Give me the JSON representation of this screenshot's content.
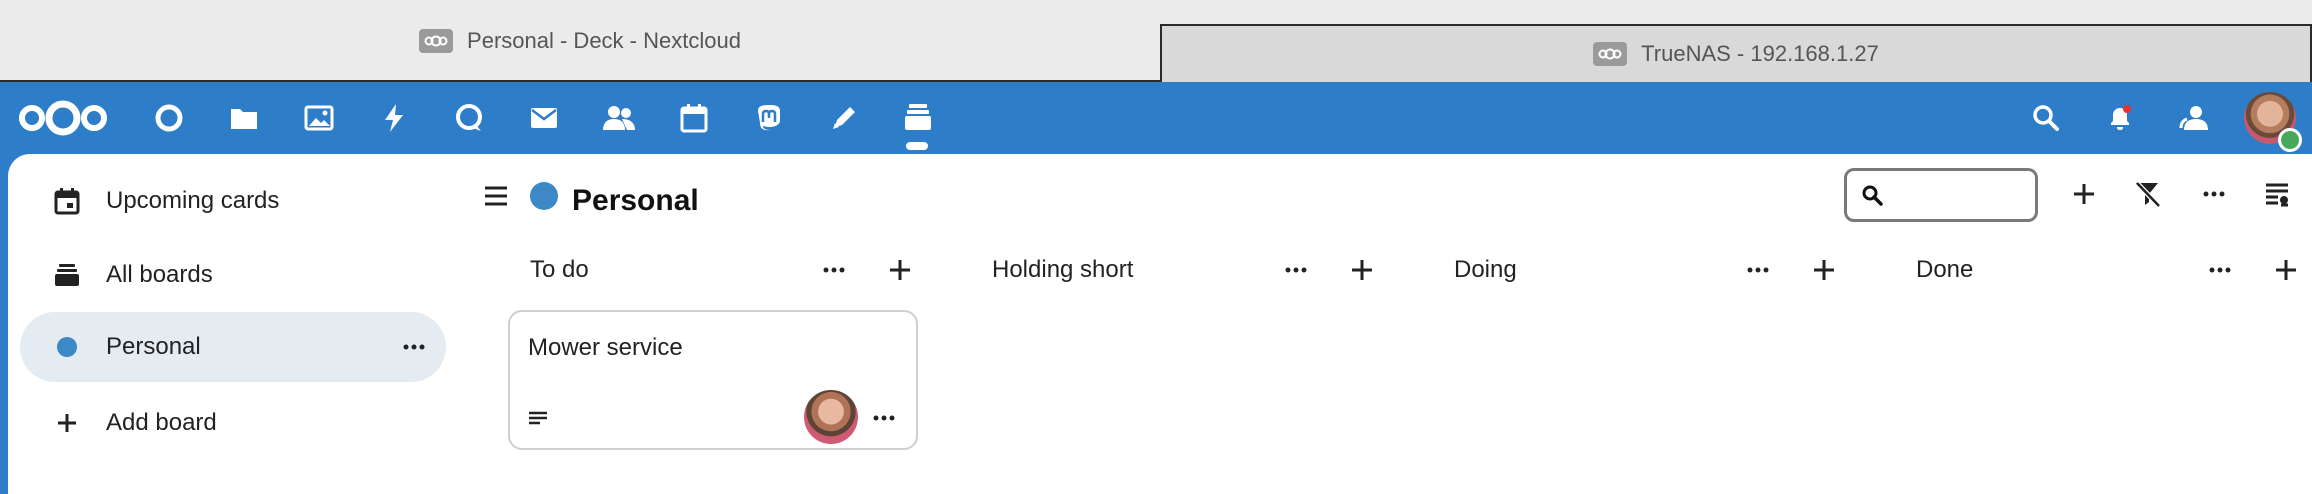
{
  "browser": {
    "tabs": [
      {
        "label": "Personal - Deck - Nextcloud",
        "active": true
      },
      {
        "label": "TrueNAS - 192.168.1.27",
        "active": false
      }
    ]
  },
  "header": {
    "logo": "nextcloud-logo",
    "apps": [
      "dashboard-icon",
      "files-icon",
      "photos-icon",
      "activity-icon",
      "talk-icon",
      "mail-icon",
      "contacts-icon",
      "calendar-icon",
      "mastodon-icon",
      "notes-icon",
      "deck-icon"
    ],
    "active_app": "deck-icon",
    "right_icons": [
      "search-icon",
      "notifications-icon",
      "contacts-menu-icon",
      "user-avatar"
    ],
    "user_status": "online"
  },
  "sidebar": {
    "items": [
      {
        "label": "Upcoming cards",
        "icon": "calendar-icon"
      },
      {
        "label": "All boards",
        "icon": "stack-icon"
      },
      {
        "label": "Personal",
        "icon": "board-dot",
        "selected": true,
        "color": "#3d88c7"
      },
      {
        "label": "Add board",
        "icon": "plus-icon"
      }
    ]
  },
  "board": {
    "title": "Personal",
    "color": "#3d88c7",
    "search_placeholder": "",
    "toolbar_icons": [
      "add-stack-icon",
      "clear-filter-icon",
      "more-icon",
      "board-details-icon"
    ]
  },
  "stacks": [
    {
      "title": "To do"
    },
    {
      "title": "Holding short"
    },
    {
      "title": "Doing"
    },
    {
      "title": "Done"
    }
  ],
  "cards": [
    {
      "stack": "To do",
      "title": "Mower service",
      "has_description": true
    }
  ],
  "colors": {
    "primary": "#2d7dc8",
    "selected_bg": "#e4ecf2",
    "status_online": "#46a85a"
  }
}
